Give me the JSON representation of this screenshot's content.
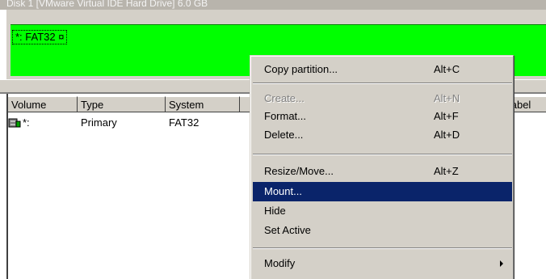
{
  "disk": {
    "title": "Disk 1 [VMware Virtual IDE Hard Drive] 6.0 GB",
    "partition_label": "*: FAT32 ¤",
    "partition_color": "#00ff00"
  },
  "list": {
    "columns": [
      "Volume",
      "Type",
      "System",
      "",
      "e label"
    ],
    "rows": [
      {
        "icon": "drive-icon",
        "volume": "*:",
        "type": "Primary",
        "system": "FAT32"
      }
    ]
  },
  "context_menu": {
    "items": [
      {
        "label": "Copy partition...",
        "accel": "Alt+C",
        "enabled": true
      },
      {
        "label": "Create...",
        "accel": "Alt+N",
        "enabled": false
      },
      {
        "label": "Format...",
        "accel": "Alt+F",
        "enabled": true
      },
      {
        "label": "Delete...",
        "accel": "Alt+D",
        "enabled": true
      },
      {
        "label": "Resize/Move...",
        "accel": "Alt+Z",
        "enabled": true
      },
      {
        "label": "Mount...",
        "accel": "",
        "enabled": true,
        "highlighted": true
      },
      {
        "label": "Hide",
        "accel": "",
        "enabled": true
      },
      {
        "label": "Set Active",
        "accel": "",
        "enabled": true
      },
      {
        "label": "Modify",
        "accel": "",
        "enabled": true,
        "submenu": true
      }
    ],
    "highlight_color": "#0a246a"
  }
}
